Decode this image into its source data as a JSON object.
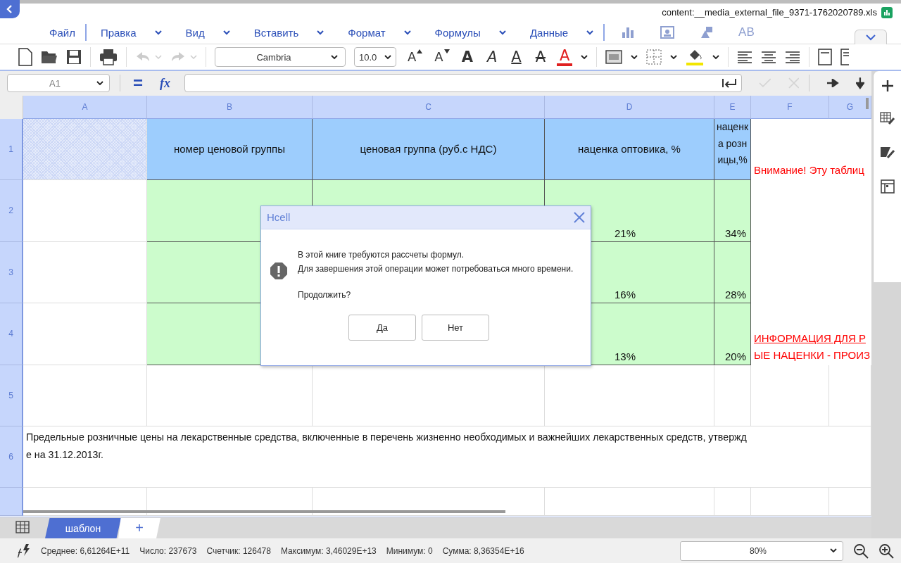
{
  "file_name": "content:__media_external_file_9371-1762020789.xls",
  "menu": [
    {
      "label": "Файл",
      "dropdown": false,
      "divider_after": true
    },
    {
      "label": "Правка",
      "dropdown": true,
      "divider_after": false
    },
    {
      "label": "Вид",
      "dropdown": true,
      "divider_after": false
    },
    {
      "label": "Вставить",
      "dropdown": true,
      "divider_after": false
    },
    {
      "label": "Формат",
      "dropdown": true,
      "divider_after": false
    },
    {
      "label": "Формулы",
      "dropdown": true,
      "divider_after": false
    },
    {
      "label": "Данные",
      "dropdown": true,
      "divider_after": true
    }
  ],
  "insert_tools": {
    "disabled": true,
    "text_art": "AB"
  },
  "toolbar": {
    "undo_disabled": true,
    "redo_disabled": true,
    "font": "Cambria",
    "font_size": "10.0",
    "text_buttons": [
      {
        "kind": "grow",
        "glyph": "A"
      },
      {
        "kind": "shrink",
        "glyph": "A"
      },
      {
        "kind": "bold",
        "glyph": "A"
      },
      {
        "kind": "italic",
        "glyph": "A"
      },
      {
        "kind": "underline",
        "glyph": "A"
      },
      {
        "kind": "strike",
        "glyph": "A"
      },
      {
        "kind": "color",
        "glyph": "A"
      }
    ]
  },
  "formula_bar": {
    "cell": "A1",
    "equals": "=",
    "fx": "fx",
    "confirm_disabled": true
  },
  "columns": [
    {
      "label": "A"
    },
    {
      "label": "B"
    },
    {
      "label": "C"
    },
    {
      "label": "D"
    },
    {
      "label": "E"
    },
    {
      "label": "F"
    },
    {
      "label": "G"
    }
  ],
  "rows": [
    {
      "number": "1",
      "kind": "cells",
      "cells": [
        {
          "kind": "selection"
        },
        {
          "kind": "header",
          "text": "номер ценовой группы"
        },
        {
          "kind": "header",
          "text": "ценовая группа (руб.с НДС)"
        },
        {
          "kind": "header",
          "text": "наценка оптовика, %"
        },
        {
          "kind": "header-narrow",
          "text": "наценка розницы,%"
        },
        {
          "kind": "note",
          "lines": [
            {
              "text": "Внимание! Эту таблиц",
              "underlined": false
            }
          ]
        }
      ]
    },
    {
      "number": "2",
      "kind": "cells",
      "cells": [
        {
          "kind": "blank"
        },
        {
          "kind": "value"
        },
        {
          "kind": "value"
        },
        {
          "kind": "value",
          "text": "21%"
        },
        {
          "kind": "value",
          "text": "34%"
        },
        {
          "kind": "empty"
        },
        {
          "kind": "empty"
        }
      ]
    },
    {
      "number": "3",
      "kind": "cells",
      "cells": [
        {
          "kind": "blank"
        },
        {
          "kind": "value"
        },
        {
          "kind": "covered"
        },
        {
          "kind": "value",
          "text": "16%"
        },
        {
          "kind": "value",
          "text": "28%"
        },
        {
          "kind": "empty"
        },
        {
          "kind": "empty"
        }
      ]
    },
    {
      "number": "4",
      "kind": "cells",
      "cells": [
        {
          "kind": "blank"
        },
        {
          "kind": "value"
        },
        {
          "kind": "covered"
        },
        {
          "kind": "value",
          "text": "13%"
        },
        {
          "kind": "value",
          "text": "20%"
        },
        {
          "kind": "note",
          "lines": [
            {
              "text": "ИНФОРМАЦИЯ ДЛЯ Р",
              "underlined": true
            },
            {
              "text": "ЫЕ НАЦЕНКИ - ПРОИЗ",
              "underlined": false
            }
          ]
        }
      ]
    },
    {
      "number": "5",
      "kind": "cells",
      "cells": [
        {
          "kind": "blank"
        },
        {
          "kind": "blank"
        },
        {
          "kind": "blank"
        },
        {
          "kind": "blank"
        },
        {
          "kind": "blank"
        },
        {
          "kind": "blank"
        },
        {
          "kind": "blank"
        }
      ]
    },
    {
      "number": "6",
      "kind": "merged",
      "lines": [
        "Предельные розничные цены на лекарственные средства, включенные в перечень жизненно необходимых и важнейших лекарственных средств, утвержд",
        "е на 31.12.2013г."
      ]
    },
    {
      "kind": "cells",
      "cells": [
        {
          "kind": "blank"
        },
        {
          "kind": "blank"
        },
        {
          "kind": "blank"
        },
        {
          "kind": "blank"
        },
        {
          "kind": "blank"
        },
        {
          "kind": "blank"
        },
        {
          "kind": "blank"
        }
      ]
    }
  ],
  "dialog": {
    "title": "Hcell",
    "lines": [
      "В этой книге требуются рассчеты формул.",
      "Для завершения этой операции может потребоваться много времени."
    ],
    "question": "Продолжить?",
    "buttons": [
      "Да",
      "Нет"
    ]
  },
  "sheet_tabs": [
    {
      "label": "шаблон",
      "selected": true
    }
  ],
  "add_sheet": "+",
  "status": [
    "Среднее: 6,61264E+11",
    "Число: 237673",
    "Счетчик: 126478",
    "Максимум: 3,46029E+13",
    "Минимум: 0",
    "Сумма: 8,36354E+16"
  ],
  "zoom": "80%"
}
